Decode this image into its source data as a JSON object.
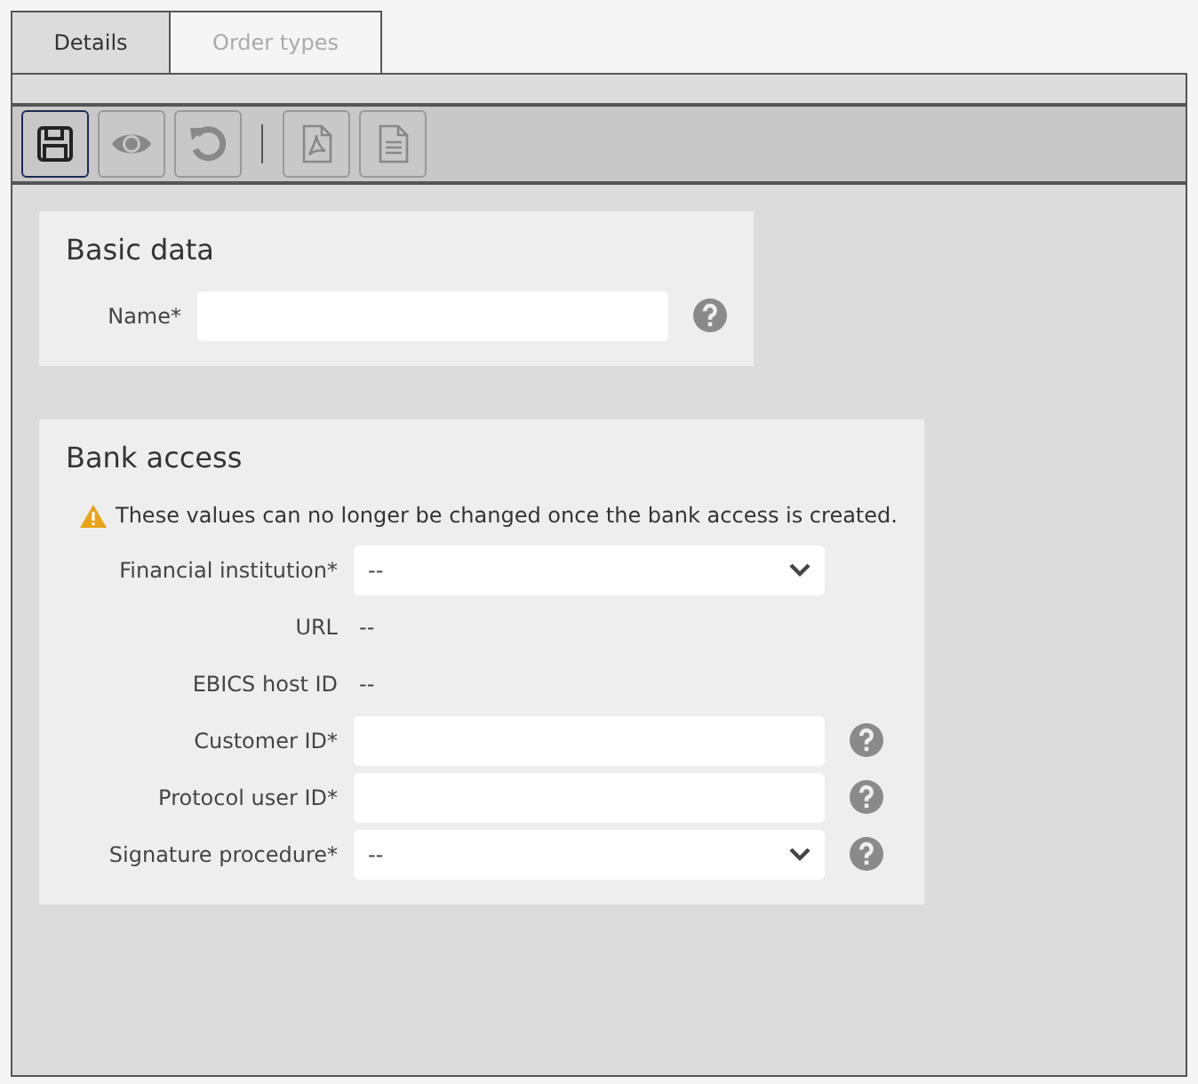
{
  "tabs": [
    {
      "label": "Details",
      "selected": true
    },
    {
      "label": "Order types",
      "selected": false
    }
  ],
  "toolbar": [
    {
      "kind": "save",
      "disabled": false
    },
    {
      "kind": "view",
      "disabled": true
    },
    {
      "kind": "reset",
      "disabled": true
    },
    {
      "kind": "separator"
    },
    {
      "kind": "pdf",
      "disabled": true
    },
    {
      "kind": "document",
      "disabled": true
    }
  ],
  "sections": [
    {
      "title": "Basic data",
      "fields": [
        {
          "kind": "text",
          "label": "Name*",
          "help": true
        }
      ]
    },
    {
      "title": "Bank access",
      "warning": "These values can no longer be changed once the bank access is created.",
      "fields": [
        {
          "kind": "select",
          "label": "Financial institution*",
          "value": "--",
          "help": false
        },
        {
          "kind": "static",
          "label": "URL",
          "value": "--",
          "help": false
        },
        {
          "kind": "static",
          "label": "EBICS host ID",
          "value": "--",
          "help": false
        },
        {
          "kind": "text",
          "label": "Customer ID*",
          "help": true
        },
        {
          "kind": "text",
          "label": "Protocol user ID*",
          "help": true
        },
        {
          "kind": "select",
          "label": "Signature procedure*",
          "value": "--",
          "help": true
        }
      ]
    }
  ]
}
